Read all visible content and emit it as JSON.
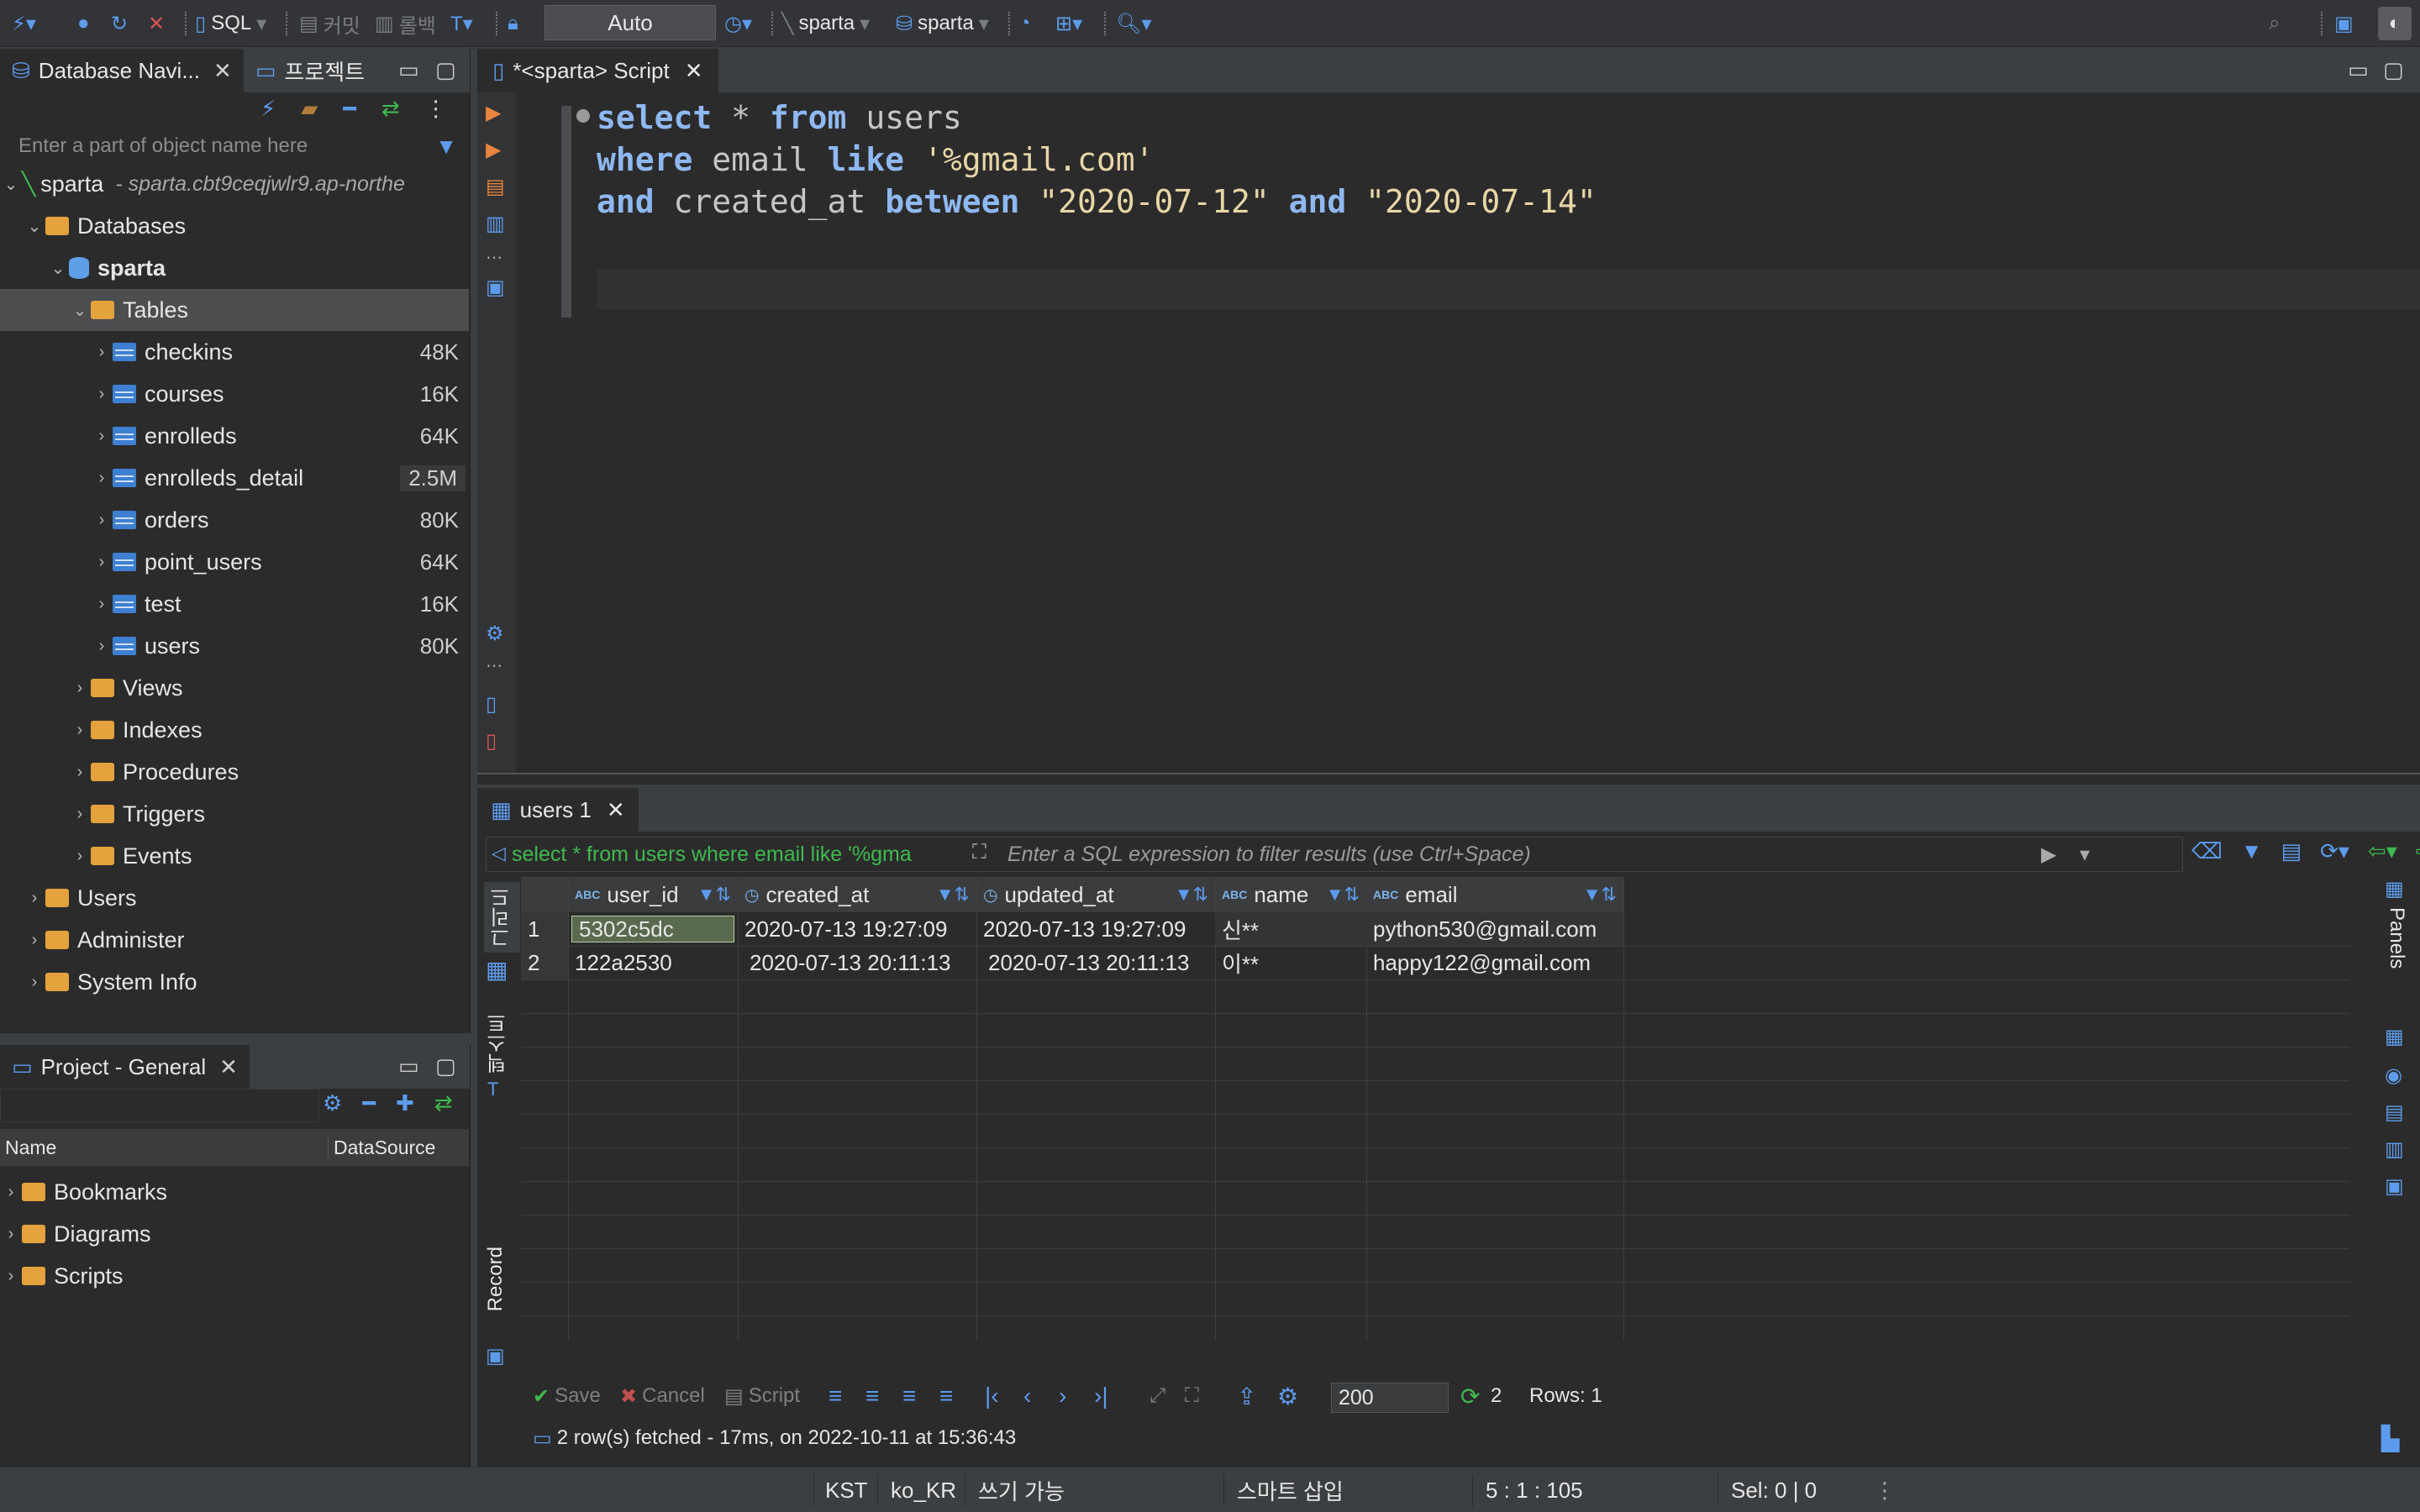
{
  "toolbar": {
    "sql_label": "SQL",
    "commit_label": "커밋",
    "rollback_label": "롤백",
    "transaction_mode": "Auto",
    "datasource": "sparta",
    "schema": "sparta"
  },
  "navigator": {
    "tab_label": "Database Navi...",
    "project_tab_label": "프로젝트",
    "search_placeholder": "Enter a part of object name here",
    "connection_name": "sparta",
    "connection_host": "- sparta.cbt9ceqjwlr9.ap-northe",
    "databases_label": "Databases",
    "schema_name": "sparta",
    "tables_label": "Tables",
    "tables": [
      {
        "name": "checkins",
        "size": "48K"
      },
      {
        "name": "courses",
        "size": "16K"
      },
      {
        "name": "enrolleds",
        "size": "64K"
      },
      {
        "name": "enrolleds_detail",
        "size": "2.5M"
      },
      {
        "name": "orders",
        "size": "80K"
      },
      {
        "name": "point_users",
        "size": "64K"
      },
      {
        "name": "test",
        "size": "16K"
      },
      {
        "name": "users",
        "size": "80K"
      }
    ],
    "schema_folders": [
      "Views",
      "Indexes",
      "Procedures",
      "Triggers",
      "Events"
    ],
    "connection_folders": [
      "Users",
      "Administer",
      "System Info"
    ]
  },
  "project": {
    "tab_label": "Project - General",
    "col_name": "Name",
    "col_datasource": "DataSource",
    "items": [
      "Bookmarks",
      "Diagrams",
      "Scripts"
    ]
  },
  "editor": {
    "tab_label": "*<sparta> Script",
    "lines": [
      [
        {
          "t": "select",
          "c": "kw"
        },
        {
          "t": " * ",
          "c": "id"
        },
        {
          "t": "from",
          "c": "kw"
        },
        {
          "t": " users",
          "c": "id"
        }
      ],
      [
        {
          "t": "where",
          "c": "kw"
        },
        {
          "t": " email ",
          "c": "id"
        },
        {
          "t": "like",
          "c": "kw"
        },
        {
          "t": " '%gmail.com'",
          "c": "str"
        }
      ],
      [
        {
          "t": "and",
          "c": "kw"
        },
        {
          "t": " created_at ",
          "c": "id"
        },
        {
          "t": "between",
          "c": "kw"
        },
        {
          "t": " \"2020-07-12\" ",
          "c": "str"
        },
        {
          "t": "and",
          "c": "kw"
        },
        {
          "t": " \"2020-07-14\"",
          "c": "str"
        }
      ]
    ]
  },
  "results": {
    "tab_label": "users 1",
    "query_preview": "select * from users where email like '%gma",
    "filter_placeholder": "Enter a SQL expression to filter results (use Ctrl+Space)",
    "side_tab_grid": "그리드",
    "side_tab_text": "텍스트",
    "side_tab_record": "Record",
    "right_panels_label": "Panels",
    "columns": [
      {
        "name": "user_id",
        "type": "ABC"
      },
      {
        "name": "created_at",
        "type": "clock"
      },
      {
        "name": "updated_at",
        "type": "clock"
      },
      {
        "name": "name",
        "type": "ABC"
      },
      {
        "name": "email",
        "type": "ABC"
      }
    ],
    "rows": [
      {
        "num": "1",
        "cells": [
          "5302c5dc",
          "2020-07-13 19:27:09",
          "2020-07-13 19:27:09",
          "신**",
          "python530@gmail.com"
        ]
      },
      {
        "num": "2",
        "cells": [
          "122a2530",
          "2020-07-13 20:11:13",
          "2020-07-13 20:11:13",
          "이**",
          "happy122@gmail.com"
        ]
      }
    ],
    "footer": {
      "save_label": "Save",
      "cancel_label": "Cancel",
      "script_label": "Script",
      "fetch_size": "200",
      "refresh_count": "2",
      "rows_label": "Rows: 1",
      "status_message": "2 row(s) fetched - 17ms, on 2022-10-11 at 15:36:43"
    }
  },
  "statusbar": {
    "timezone": "KST",
    "locale": "ko_KR",
    "mode": "쓰기 가능",
    "insert_mode": "스마트 삽입",
    "cursor_pos": "5 : 1 : 105",
    "selection": "Sel: 0 | 0"
  }
}
